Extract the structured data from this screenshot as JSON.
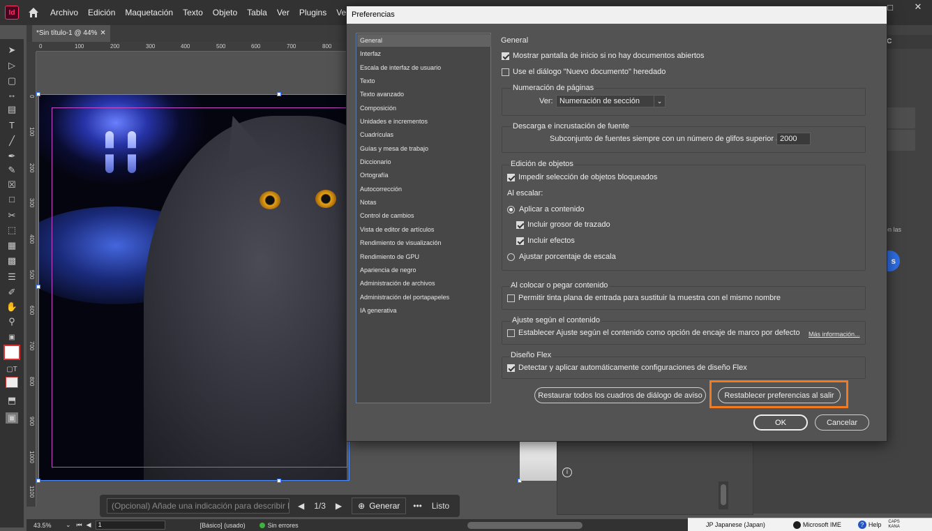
{
  "app": {
    "logo_text": "Id",
    "menu": [
      "Archivo",
      "Edición",
      "Maquetación",
      "Texto",
      "Objeto",
      "Tabla",
      "Ver",
      "Plugins",
      "Ventana"
    ]
  },
  "document": {
    "tab_title": "*Sin título-1 @ 44%",
    "ruler_h_labels": [
      "0",
      "100",
      "200",
      "300",
      "400",
      "500",
      "600",
      "700",
      "800"
    ],
    "ruler_v_labels": [
      "0",
      "100",
      "200",
      "300",
      "400",
      "500",
      "600",
      "700",
      "800",
      "900",
      "1000",
      "1100"
    ]
  },
  "dialog": {
    "title": "Preferencias",
    "categories": [
      "General",
      "Interfaz",
      "Escala de interfaz de usuario",
      "Texto",
      "Texto avanzado",
      "Composición",
      "Unidades e incrementos",
      "Cuadrículas",
      "Guías y mesa de trabajo",
      "Diccionario",
      "Ortografía",
      "Autocorrección",
      "Notas",
      "Control de cambios",
      "Vista de editor de artículos",
      "Rendimiento de visualización",
      "Rendimiento de GPU",
      "Apariencia de negro",
      "Administración de archivos",
      "Administración del portapapeles",
      "IA generativa"
    ],
    "selected_category": "General",
    "section_title": "General",
    "show_start_screen": {
      "label": "Mostrar pantalla de inicio si no hay documentos abiertos",
      "checked": true
    },
    "legacy_new_doc": {
      "label": "Use el diálogo \"Nuevo documento\" heredado",
      "checked": false
    },
    "page_numbering": {
      "title": "Numeración de páginas",
      "view_label": "Ver:",
      "view_value": "Numeración de sección"
    },
    "font_download": {
      "title": "Descarga e incrustación de fuente",
      "subset_label": "Subconjunto de fuentes siempre con un número de glifos superior a:",
      "subset_value": "2000"
    },
    "object_editing": {
      "title": "Edición de objetos",
      "prevent_locked": {
        "label": "Impedir selección de objetos bloqueados",
        "checked": true
      },
      "scaling_label": "Al escalar:",
      "apply_to_content": {
        "label": "Aplicar a contenido",
        "selected": true
      },
      "include_stroke": {
        "label": "Incluir grosor de trazado",
        "checked": true
      },
      "include_effects": {
        "label": "Incluir efectos",
        "checked": true
      },
      "adjust_scale": {
        "label": "Ajustar porcentaje de escala",
        "selected": false
      }
    },
    "place_paste": {
      "title": "Al colocar o pegar contenido",
      "spot_color": {
        "label": "Permitir tinta plana de entrada para sustituir la muestra con el mismo nombre",
        "checked": false
      }
    },
    "content_aware": {
      "title": "Ajuste según el contenido",
      "option": {
        "label": "Establecer Ajuste según el contenido como opción de encaje de marco por defecto",
        "checked": false
      },
      "more_info": "Más información..."
    },
    "flex_layout": {
      "title": "Diseño Flex",
      "option": {
        "label": "Detectar y aplicar automáticamente configuraciones de diseño Flex",
        "checked": true
      }
    },
    "buttons": {
      "reset_dialogs": "Restaurar todos los cuadros de diálogo de aviso",
      "reset_prefs": "Restablecer preferencias al salir",
      "ok": "OK",
      "cancel": "Cancelar"
    },
    "highlight_color": "#f47a1f"
  },
  "right_panel": {
    "header_fragment": "as CC",
    "text_fragment": "on las",
    "button_fragment": "s"
  },
  "ai_bar": {
    "placeholder": "(Opcional) Añade una indicación para describir la ampliac",
    "page_counter": "1/3",
    "generate": "Generar",
    "more": "•••",
    "done": "Listo"
  },
  "status": {
    "zoom": "43.5%",
    "page": "1",
    "preset": "[Básico] (usado)",
    "errors": "Sin errores"
  },
  "taskbar": {
    "ime": "JP Japanese (Japan)",
    "microsoft_ime": "Microsoft IME",
    "help": "Help",
    "caps": "CAPS",
    "kana": "KANA"
  }
}
